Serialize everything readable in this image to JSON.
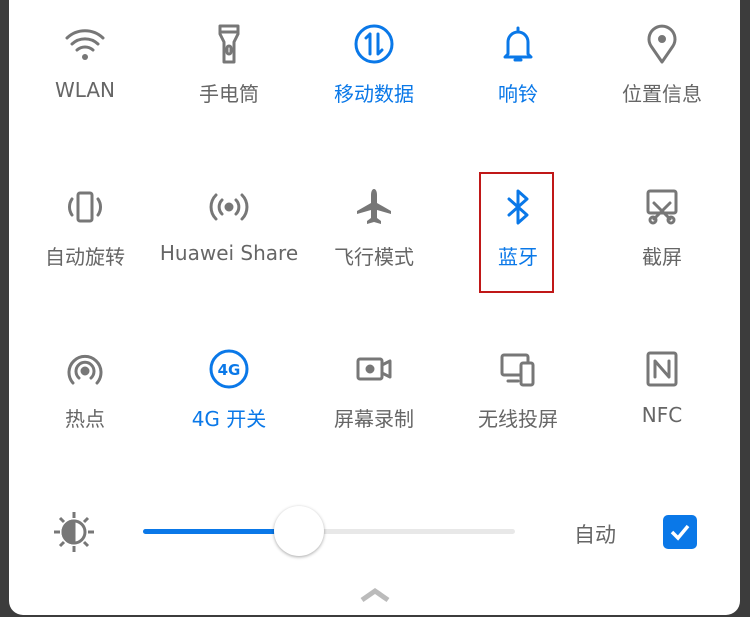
{
  "tiles": [
    {
      "label": "WLAN",
      "icon": "wifi-icon",
      "active": false
    },
    {
      "label": "手电筒",
      "icon": "flashlight-icon",
      "active": false
    },
    {
      "label": "移动数据",
      "icon": "mobile-data-icon",
      "active": true
    },
    {
      "label": "响铃",
      "icon": "bell-icon",
      "active": true
    },
    {
      "label": "位置信息",
      "icon": "location-icon",
      "active": false
    },
    {
      "label": "自动旋转",
      "icon": "auto-rotate-icon",
      "active": false
    },
    {
      "label": "Huawei Share",
      "icon": "huawei-share-icon",
      "active": false
    },
    {
      "label": "飞行模式",
      "icon": "airplane-icon",
      "active": false
    },
    {
      "label": "蓝牙",
      "icon": "bluetooth-icon",
      "active": true,
      "highlighted": true
    },
    {
      "label": "截屏",
      "icon": "screenshot-icon",
      "active": false
    },
    {
      "label": "热点",
      "icon": "hotspot-icon",
      "active": false
    },
    {
      "label": "4G 开关",
      "icon": "4g-icon",
      "active": true
    },
    {
      "label": "屏幕录制",
      "icon": "screen-record-icon",
      "active": false
    },
    {
      "label": "无线投屏",
      "icon": "wireless-projection-icon",
      "active": false
    },
    {
      "label": "NFC",
      "icon": "nfc-icon",
      "active": false
    }
  ],
  "brightness": {
    "level": 0.42,
    "auto_label": "自动",
    "auto_checked": true
  },
  "colors": {
    "accent": "#0a78e8",
    "inactive": "#666666",
    "highlight": "#c01818"
  }
}
